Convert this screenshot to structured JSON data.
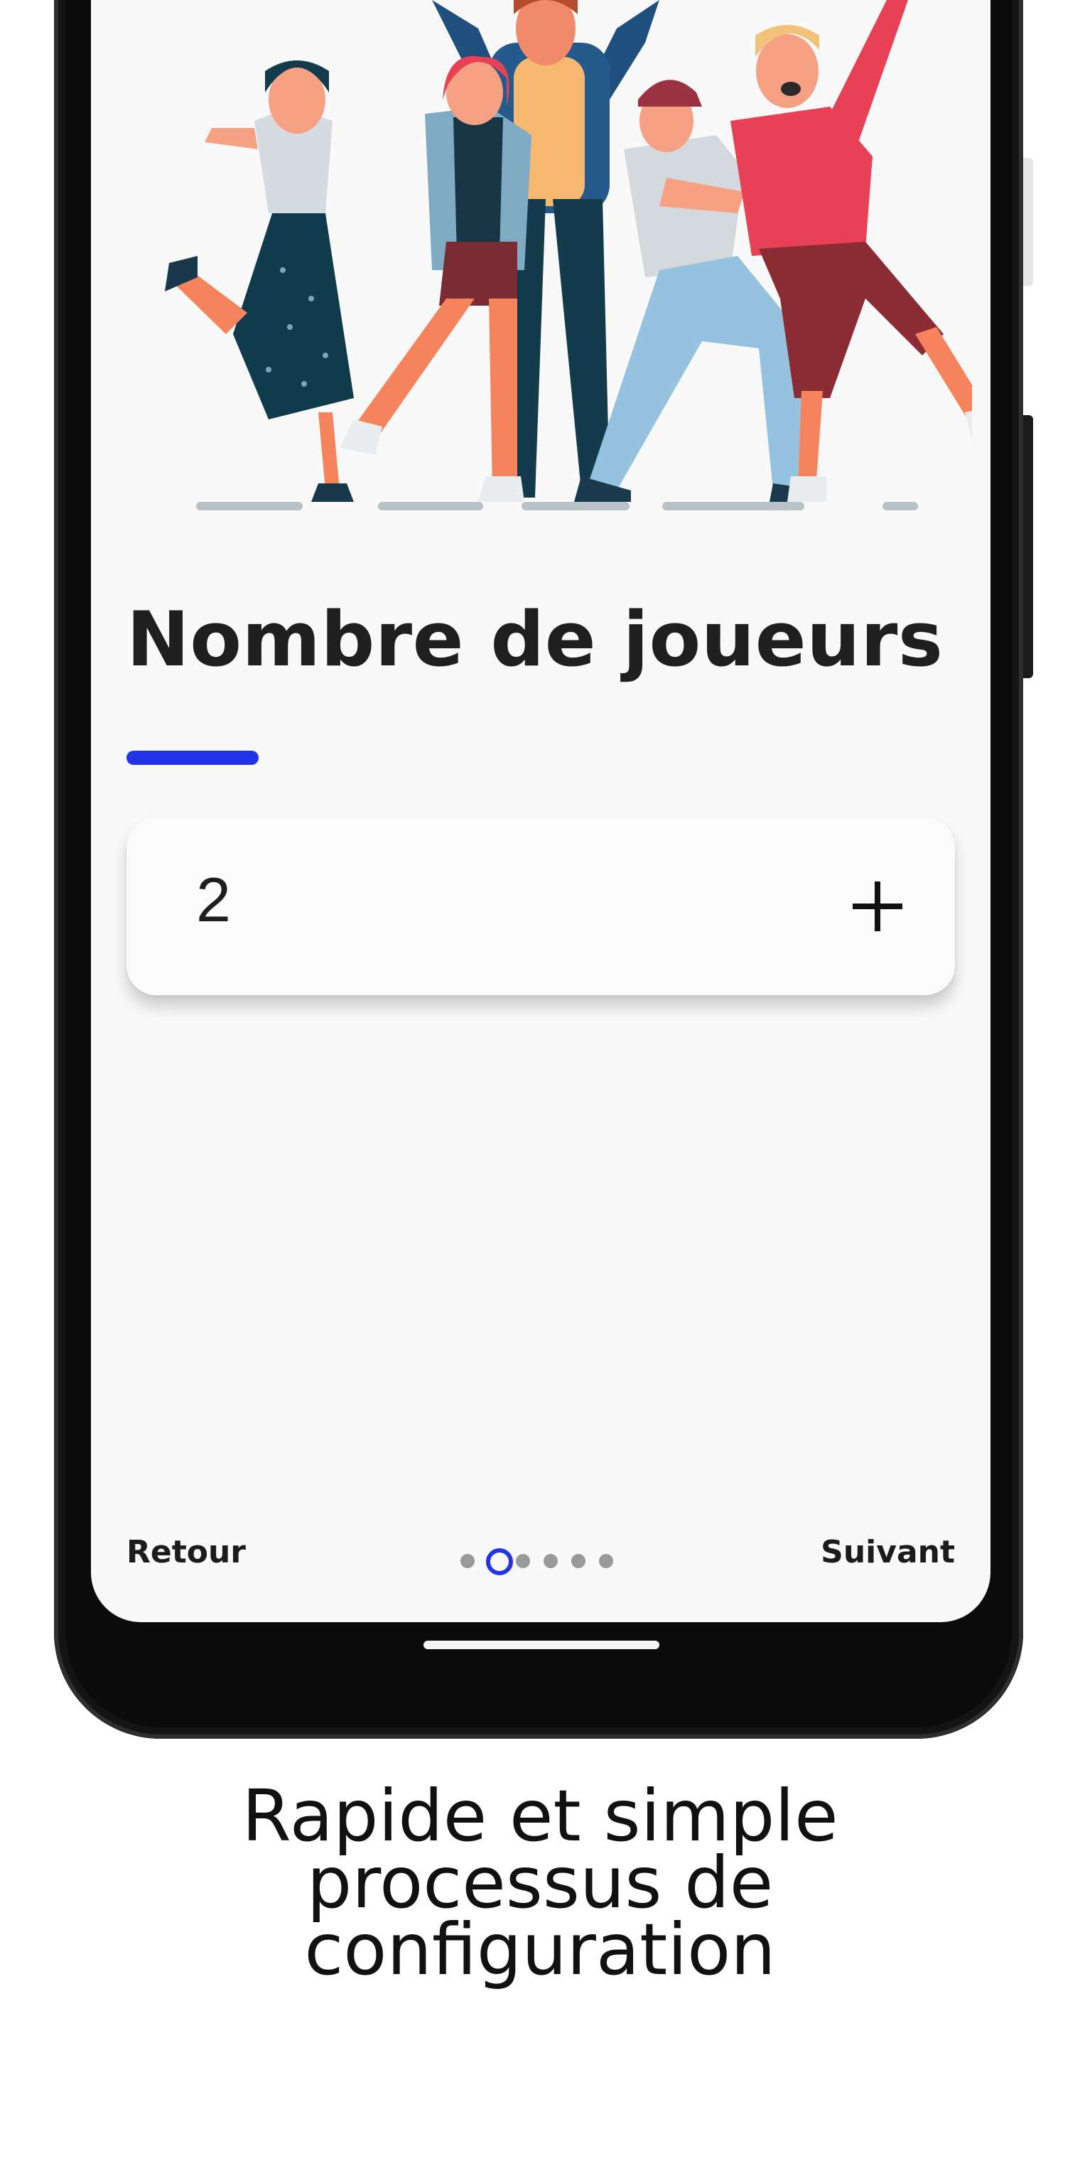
{
  "screen": {
    "title": "Nombre de joueurs",
    "accent_color": "#2233e8",
    "player_count": {
      "value": "2",
      "increment_icon": "plus-icon"
    },
    "footer": {
      "back_label": "Retour",
      "next_label": "Suivant",
      "pagination": {
        "total": 6,
        "current": 2
      }
    }
  },
  "caption": {
    "lines": [
      "Rapide et simple",
      "processus de",
      "configuration"
    ]
  }
}
